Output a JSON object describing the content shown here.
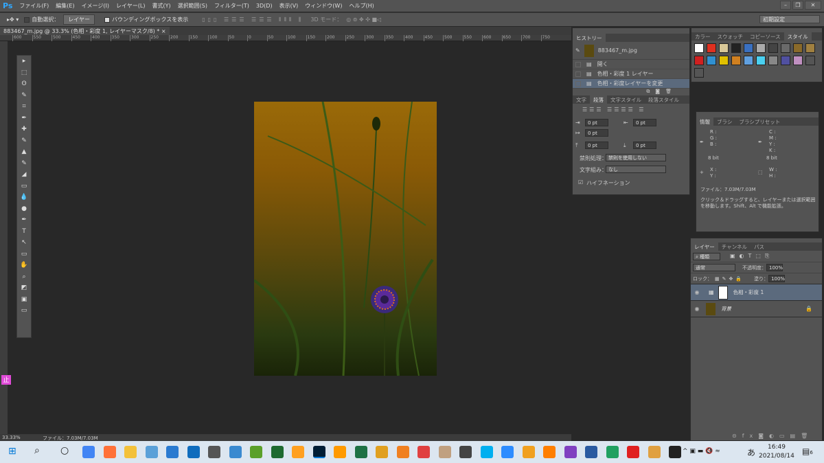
{
  "app": {
    "logo": "Ps",
    "menu": [
      "ファイル(F)",
      "編集(E)",
      "イメージ(I)",
      "レイヤー(L)",
      "書式(Y)",
      "選択範囲(S)",
      "フィルター(T)",
      "3D(D)",
      "表示(V)",
      "ウィンドウ(W)",
      "ヘルプ(H)"
    ],
    "window_buttons": [
      "–",
      "❐",
      "✕"
    ]
  },
  "options": {
    "auto_select_label": "自動選択：",
    "auto_select_value": "レイヤー",
    "auto_select_checked": false,
    "bounding_box_label": "バウンディングボックスを表示",
    "bounding_box_checked": true,
    "mode_3d_label": "3D モード：",
    "workspace": "初期設定"
  },
  "document": {
    "tab_title": "883467_m.jpg @ 33.3% (色相・彩度 1, レイヤーマスク/8) *",
    "close": "×",
    "ruler_labels": [
      "600",
      "550",
      "500",
      "450",
      "400",
      "350",
      "300",
      "250",
      "200",
      "150",
      "100",
      "50",
      "0",
      "50",
      "100",
      "150",
      "200",
      "250",
      "300",
      "350",
      "400",
      "450",
      "500",
      "550",
      "600",
      "650",
      "700",
      "750"
    ]
  },
  "status": {
    "zoom": "33.33%",
    "file": "ファイル：7.03M/7.03M"
  },
  "history": {
    "tab": "ヒストリー",
    "snapshot": "883467_m.jpg",
    "items": [
      {
        "label": "開く"
      },
      {
        "label": "色相・彩度 1 レイヤー"
      },
      {
        "label": "色相・彩度レイヤーを変更",
        "selected": true
      }
    ]
  },
  "paragraph": {
    "tabs": [
      "文字",
      "段落",
      "文字スタイル",
      "段落スタイル"
    ],
    "active_tab": "段落",
    "indent_left": "0 pt",
    "indent_right": "0 pt",
    "indent_first": "0 pt",
    "space_before": "0 pt",
    "space_after": "0 pt",
    "kinsoku_label": "禁則処理：",
    "kinsoku_value": "禁則を使用しない",
    "mojikumi_label": "文字組み：",
    "mojikumi_value": "なし",
    "hyphenation_label": "ハイフネーション",
    "hyphenation_checked": true
  },
  "styles": {
    "tabs": [
      "カラー",
      "スウォッチ",
      "コピーソース",
      "スタイル"
    ],
    "active_tab": "スタイル"
  },
  "info": {
    "tabs": [
      "情報",
      "ブラシ",
      "ブラシプリセット"
    ],
    "rgb": [
      "R :",
      "G :",
      "B :"
    ],
    "cmyk": [
      "C :",
      "M :",
      "Y :",
      "K :"
    ],
    "bit_left": "8 bit",
    "bit_right": "8 bit",
    "xy": [
      "X :",
      "Y :"
    ],
    "wh": [
      "W :",
      "H :"
    ],
    "file": "ファイル：7.03M/7.03M",
    "hint": "クリック＆ドラッグすると、レイヤーまたは選択範囲を移動します。Shift、Alt で機能拡張。"
  },
  "layers": {
    "tabs": [
      "レイヤー",
      "チャンネル",
      "パス"
    ],
    "filter": "種類",
    "blend": "通常",
    "opacity_label": "不透明度：",
    "opacity": "100%",
    "lock_label": "ロック：",
    "fill_label": "塗り：",
    "fill": "100%",
    "items": [
      {
        "name": "色相・彩度 1",
        "selected": true
      },
      {
        "name": "背景",
        "locked": true
      }
    ]
  },
  "taskbar": {
    "time": "16:49",
    "date": "2021/08/14",
    "ime": "あ",
    "notifications": "6"
  }
}
